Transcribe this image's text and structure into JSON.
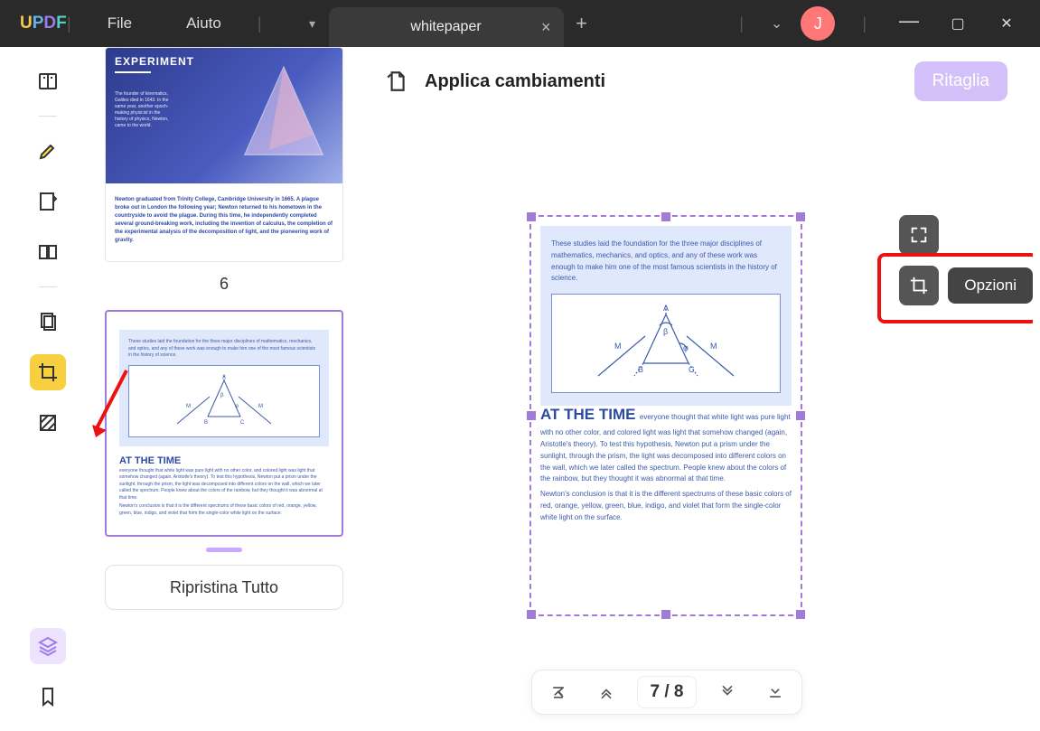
{
  "titlebar": {
    "logo": "UPDF",
    "menus": {
      "file": "File",
      "help": "Aiuto"
    },
    "tab_name": "whitepaper",
    "avatar_initial": "J"
  },
  "sidebar": {
    "items": [
      {
        "name": "reader",
        "label": "Reader"
      },
      {
        "name": "highlight",
        "label": "Highlight"
      },
      {
        "name": "edit",
        "label": "Edit"
      },
      {
        "name": "two-page",
        "label": "Two Page"
      },
      {
        "name": "organize",
        "label": "Organize Pages"
      },
      {
        "name": "crop",
        "label": "Crop"
      },
      {
        "name": "background",
        "label": "Background"
      }
    ],
    "bottom": [
      {
        "name": "layers",
        "label": "Layers"
      },
      {
        "name": "bookmark",
        "label": "Bookmark"
      }
    ]
  },
  "thumbs": {
    "page6": {
      "title": "EXPERIMENT",
      "small_para": "The founder of kinematics, Galileo died in 1643. In the same year, another epoch-making physicist in the history of physics, Newton, came to the world.",
      "body": "Newton graduated from Trinity College, Cambridge University in 1665. A plague broke out in London the following year; Newton returned to his hometown in the countryside to avoid the plague. During this time, he independently completed several ground-breaking work, including the invention of calculus, the completion of the experimental analysis of the decomposition of light, and the pioneering work of gravity.",
      "label": "6"
    },
    "page7": {
      "para1": "These studies laid the foundation for the three major disciplines of mathematics, mechanics, and optics, and any of these work was enough to make him one of the most famous scientists in the history of science.",
      "title": "AT THE TIME",
      "para2": "everyone thought that white light was pure light with no other color, and colored light was light that somehow changed (again, Aristotle's theory). To test this hypothesis, Newton put a prism under the sunlight, through the prism, the light was decomposed into different colors on the wall, which we later called the spectrum. People knew about the colors of the rainbow, but they thought it was abnormal at that time.",
      "para3": "Newton's conclusion is that it is the different spectrums of these basic colors of red, orange, yellow, green, blue, indigo, and violet that form the single-color white light on the surface."
    },
    "restore": "Ripristina Tutto"
  },
  "canvas": {
    "header": "Applica cambiamenti",
    "crop": "Ritaglia",
    "options": "Opzioni",
    "page": {
      "para1": "These studies laid the foundation for the three major disciplines of mathematics, mechanics, and optics, and any of these work was enough to make him one of the most famous scientists in the history of science.",
      "title": "AT THE TIME",
      "para2_inline": "everyone thought that white light was pure light",
      "para2": "with no other color, and colored light was light that somehow changed (again, Aristotle's theory). To test this hypothesis, Newton put a prism under the sunlight, through the prism, the light was decomposed into different colors on the wall, which we later called the spectrum. People knew about the colors of the rainbow, but they thought it was abnormal at that time.",
      "para3": "Newton's conclusion is that it is the different spectrums of these basic colors of red, orange, yellow, green, blue, indigo, and violet that form the single-color white light on the surface."
    }
  },
  "pager": {
    "current": "7  /  8"
  },
  "diagram": {
    "A": "A",
    "B": "B",
    "C": "C",
    "M": "M",
    "beta": "β",
    "phi": "φ"
  }
}
